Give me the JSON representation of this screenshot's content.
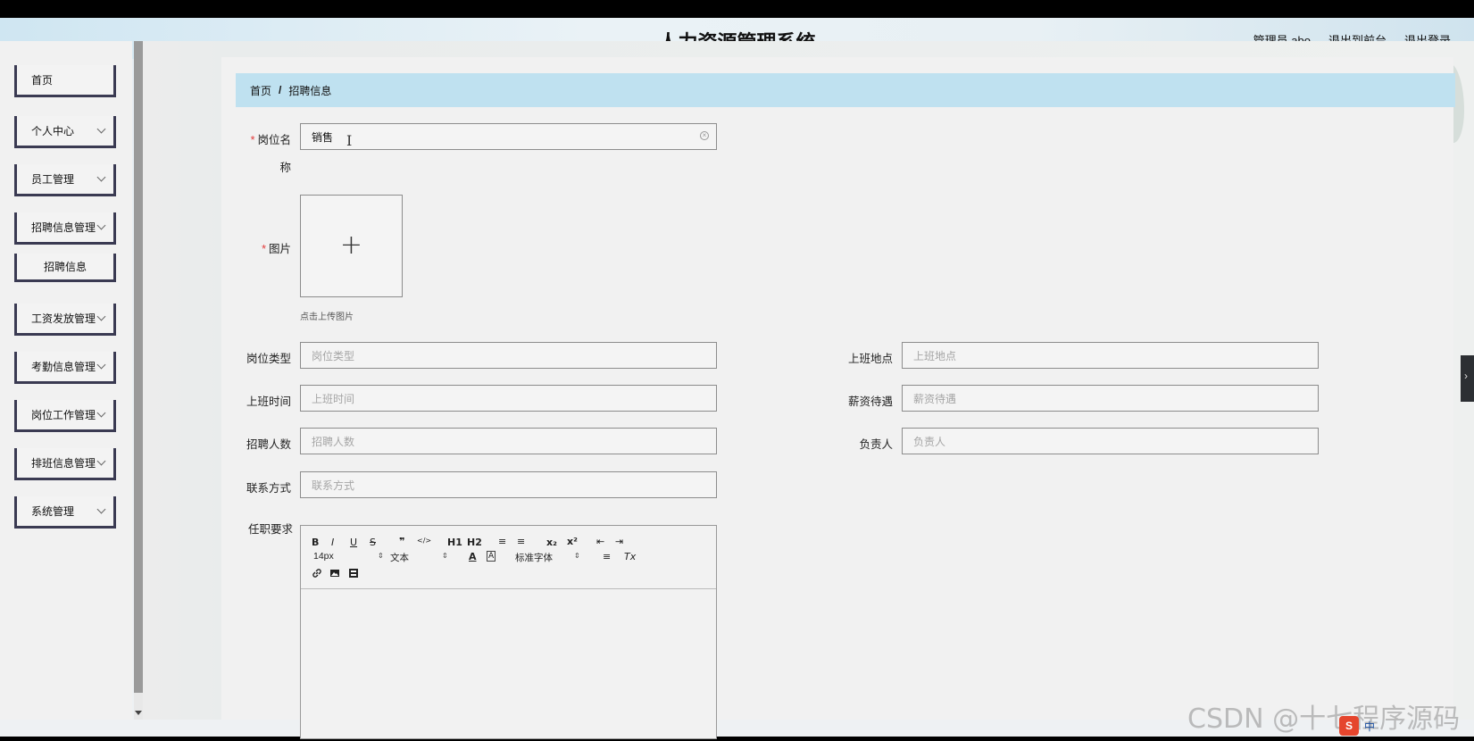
{
  "header": {
    "title": "人力资源管理系统",
    "user": "管理员 abo",
    "to_front": "退出到前台",
    "logout": "退出登录"
  },
  "sidebar": {
    "items": [
      {
        "label": "首页",
        "has_arrow": false
      },
      {
        "label": "个人中心",
        "has_arrow": true
      },
      {
        "label": "员工管理",
        "has_arrow": true
      },
      {
        "label": "招聘信息管理",
        "has_arrow": true
      },
      {
        "label": "工资发放管理",
        "has_arrow": true
      },
      {
        "label": "考勤信息管理",
        "has_arrow": true
      },
      {
        "label": "岗位工作管理",
        "has_arrow": true
      },
      {
        "label": "排班信息管理",
        "has_arrow": true
      },
      {
        "label": "系统管理",
        "has_arrow": true
      }
    ],
    "sub_item": "招聘信息"
  },
  "breadcrumb": {
    "home": "首页",
    "separator": "/",
    "current": "招聘信息"
  },
  "form": {
    "job_name": {
      "label_line1": "岗位名",
      "label_line2": "称",
      "value": "销售"
    },
    "image": {
      "label": "图片",
      "hint": "点击上传图片",
      "plus": "+"
    },
    "job_type": {
      "label": "岗位类型",
      "placeholder": "岗位类型"
    },
    "location": {
      "label": "上班地点",
      "placeholder": "上班地点"
    },
    "work_time": {
      "label": "上班时间",
      "placeholder": "上班时间"
    },
    "salary": {
      "label": "薪资待遇",
      "placeholder": "薪资待遇"
    },
    "headcount": {
      "label": "招聘人数",
      "placeholder": "招聘人数"
    },
    "manager": {
      "label": "负责人",
      "placeholder": "负责人"
    },
    "contact": {
      "label": "联系方式",
      "placeholder": "联系方式"
    },
    "requirements": {
      "label": "任职要求"
    },
    "required_mark": "*"
  },
  "editor": {
    "font_size": "14px",
    "paragraph": "文本",
    "font_family": "标准字体",
    "buttons": {
      "bold": "B",
      "italic": "I",
      "underline": "U",
      "strike": "S",
      "quote": "❞",
      "code": "</>",
      "h1": "H1",
      "h2": "H2",
      "ol": "≡",
      "ul": "≡",
      "sub": "x₂",
      "sup": "x²",
      "outdent": "⇤",
      "indent": "⇥",
      "color": "A",
      "bg": "A",
      "align": "≡",
      "clean": "Tx"
    }
  },
  "watermark": "CSDN @十七程序源码",
  "ime": {
    "logo": "S",
    "lang": "中"
  }
}
